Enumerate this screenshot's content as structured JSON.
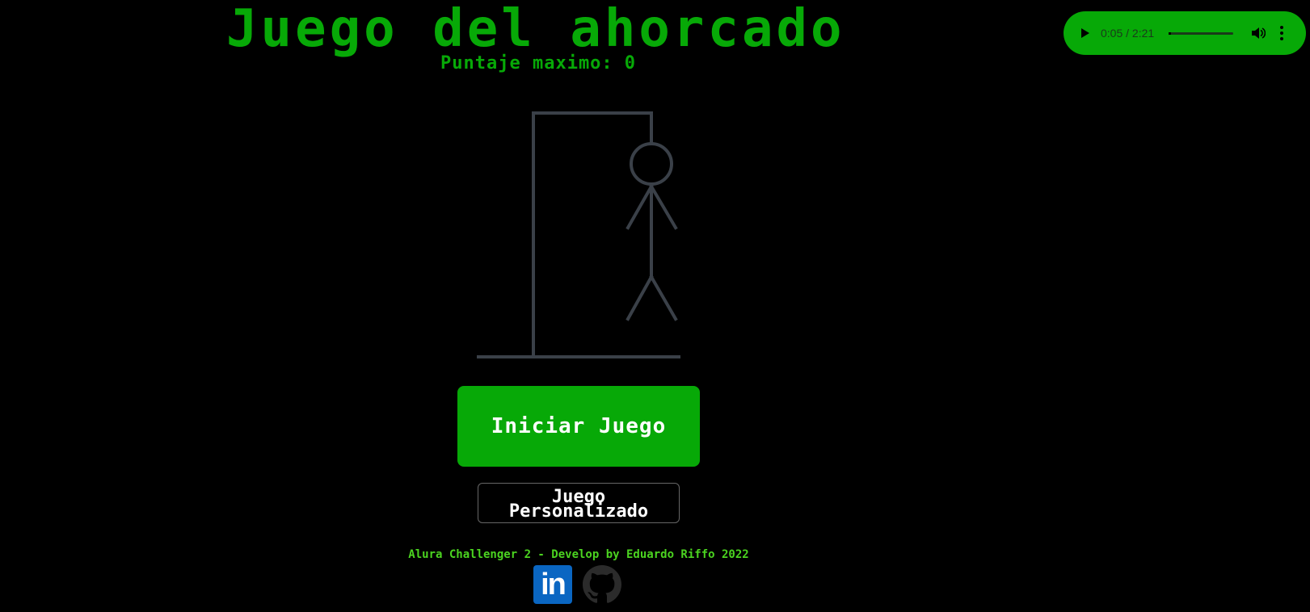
{
  "header": {
    "title": "Juego del ahorcado",
    "score_label": "Puntaje maximo:",
    "score_value": "0"
  },
  "audio_player": {
    "time": "0:05 / 2:21",
    "progress": 0.035,
    "icons": [
      "play-icon",
      "volume-icon",
      "more-options-icon"
    ]
  },
  "game": {
    "start_button": "Iniciar Juego",
    "custom_button_line1": "Juego",
    "custom_button_line2": "Personalizado"
  },
  "footer": {
    "credit": "Alura Challenger 2 - Develop by Eduardo Riffo 2022",
    "social": [
      {
        "name": "linkedin-icon",
        "label": "in"
      },
      {
        "name": "github-icon"
      }
    ]
  },
  "colors": {
    "background": "#000000",
    "accent_green": "#07a907",
    "footer_green": "#4bd320",
    "gallows": "#3a4048",
    "linkedin_blue": "#0a66c2"
  }
}
